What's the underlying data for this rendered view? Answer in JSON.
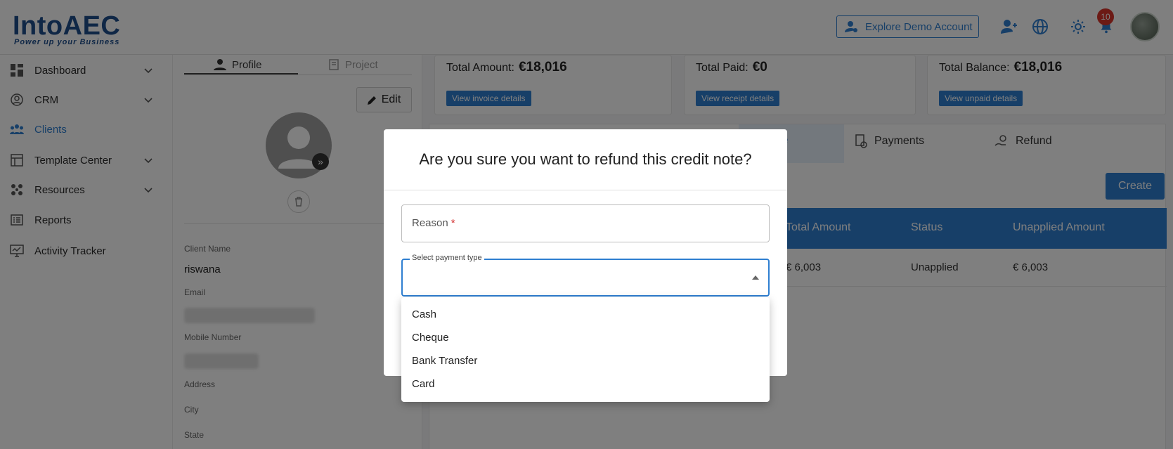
{
  "header": {
    "logo_text": "IntoAEC",
    "logo_tagline": "Power up your Business",
    "explore_label": "Explore Demo Account",
    "notification_count": "10",
    "colors": {
      "accent": "#2f7fd1",
      "brand": "#1f4e8c",
      "badge": "#d9342b"
    }
  },
  "sidebar": {
    "items": [
      {
        "label": "Dashboard",
        "icon": "dashboard-icon",
        "expandable": true
      },
      {
        "label": "CRM",
        "icon": "crm-icon",
        "expandable": true
      },
      {
        "label": "Clients",
        "icon": "clients-icon",
        "expandable": false,
        "active": true
      },
      {
        "label": "Template Center",
        "icon": "template-icon",
        "expandable": true
      },
      {
        "label": "Resources",
        "icon": "resources-icon",
        "expandable": true
      },
      {
        "label": "Reports",
        "icon": "reports-icon",
        "expandable": false
      },
      {
        "label": "Activity Tracker",
        "icon": "activity-icon",
        "expandable": false
      }
    ]
  },
  "profile": {
    "tabs": [
      "Profile",
      "Project"
    ],
    "edit_label": "Edit",
    "client_name_label": "Client Name",
    "client_name": "riswana",
    "email_label": "Email",
    "mobile_label": "Mobile Number",
    "address_label": "Address",
    "city_label": "City",
    "state_label": "State"
  },
  "summary": {
    "total_amount_label": "Total Amount:",
    "total_amount": "€18,016",
    "invoice_btn": "View invoice details",
    "total_paid_label": "Total Paid:",
    "total_paid": "€0",
    "receipt_btn": "View receipt details",
    "total_balance_label": "Total Balance:",
    "total_balance": "€18,016",
    "unpaid_btn": "View unpaid details"
  },
  "main": {
    "tabs": {
      "active_partial": "te",
      "payments": "Payments",
      "refund": "Refund"
    },
    "create_label": "Create",
    "table": {
      "headers": [
        "Total Amount",
        "Status",
        "Unapplied Amount"
      ],
      "rows": [
        [
          "€ 6,003",
          "Unapplied",
          "€ 6,003"
        ]
      ]
    }
  },
  "modal": {
    "title": "Are you sure you want to refund this credit note?",
    "reason_placeholder": "Reason",
    "reason_required": "*",
    "payment_type_label": "Select payment type",
    "options": [
      "Cash",
      "Cheque",
      "Bank Transfer",
      "Card"
    ]
  }
}
